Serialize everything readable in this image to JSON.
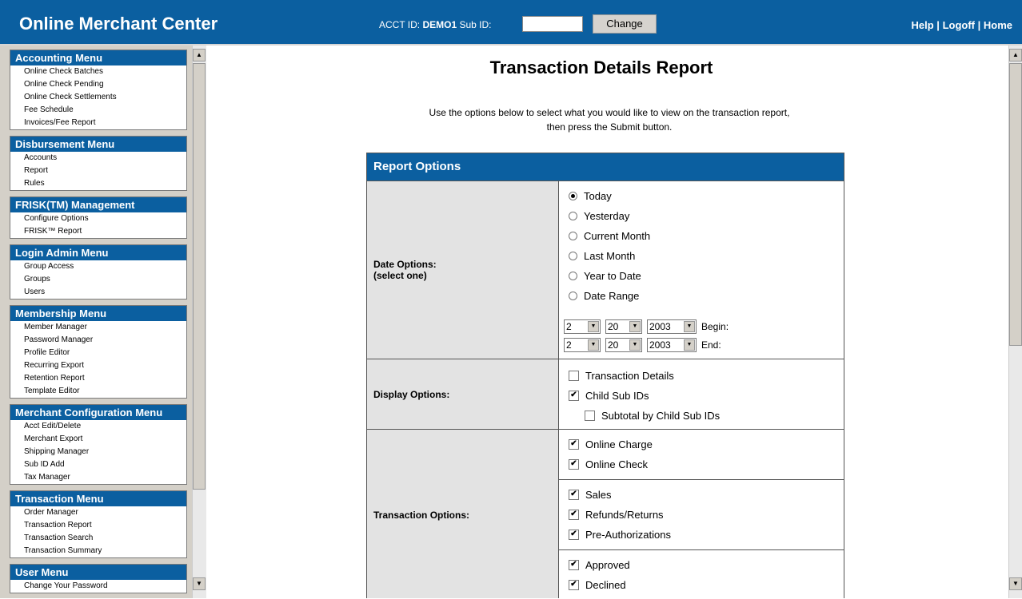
{
  "header": {
    "app_title": "Online Merchant Center",
    "acct_label": "ACCT ID:",
    "acct_value": "DEMO1",
    "subid_label": "Sub ID:",
    "subid_value": "",
    "change_label": "Change",
    "links": {
      "help": "Help",
      "logoff": "Logoff",
      "home": "Home",
      "sep": "|"
    }
  },
  "sidebar": {
    "menus": [
      {
        "title": "Accounting Menu",
        "items": [
          "Online Check Batches",
          "Online Check Pending",
          "Online Check Settlements",
          "Fee Schedule",
          "Invoices/Fee Report"
        ]
      },
      {
        "title": "Disbursement Menu",
        "items": [
          "Accounts",
          "Report",
          "Rules"
        ]
      },
      {
        "title": "FRISK(TM) Management",
        "items": [
          "Configure Options",
          "FRISK™ Report"
        ]
      },
      {
        "title": "Login Admin Menu",
        "items": [
          "Group Access",
          "Groups",
          "Users"
        ]
      },
      {
        "title": "Membership Menu",
        "items": [
          "Member Manager",
          "Password Manager",
          "Profile Editor",
          "Recurring Export",
          "Retention Report",
          "Template Editor"
        ]
      },
      {
        "title": "Merchant Configuration Menu",
        "items": [
          "Acct Edit/Delete",
          "Merchant Export",
          "Shipping Manager",
          "Sub ID Add",
          "Tax Manager"
        ]
      },
      {
        "title": "Transaction Menu",
        "items": [
          "Order Manager",
          "Transaction Report",
          "Transaction Search",
          "Transaction Summary"
        ]
      },
      {
        "title": "User Menu",
        "items": [
          "Change Your Password"
        ]
      }
    ]
  },
  "main": {
    "title": "Transaction Details Report",
    "intro_line1": "Use the options below to select what you would like to view on the transaction report,",
    "intro_line2": "then press the Submit button.",
    "report": {
      "heading": "Report Options",
      "date": {
        "label_line1": "Date Options:",
        "label_line2": "(select one)",
        "options": [
          {
            "label": "Today",
            "checked": true
          },
          {
            "label": "Yesterday",
            "checked": false
          },
          {
            "label": "Current Month",
            "checked": false
          },
          {
            "label": "Last Month",
            "checked": false
          },
          {
            "label": "Year to Date",
            "checked": false
          },
          {
            "label": "Date Range",
            "checked": false
          }
        ],
        "begin": {
          "month": "2",
          "day": "20",
          "year": "2003",
          "label": "Begin:"
        },
        "end": {
          "month": "2",
          "day": "20",
          "year": "2003",
          "label": "End:"
        }
      },
      "display": {
        "label": "Display Options:",
        "options": [
          {
            "label": "Transaction Details",
            "checked": false
          },
          {
            "label": "Child Sub IDs",
            "checked": true
          },
          {
            "label": "Subtotal by Child Sub IDs",
            "checked": false
          }
        ]
      },
      "transaction": {
        "label": "Transaction Options:",
        "group1": [
          {
            "label": "Online Charge",
            "checked": true
          },
          {
            "label": "Online Check",
            "checked": true
          }
        ],
        "group2": [
          {
            "label": "Sales",
            "checked": true
          },
          {
            "label": "Refunds/Returns",
            "checked": true
          },
          {
            "label": "Pre-Authorizations",
            "checked": true
          }
        ],
        "group3": [
          {
            "label": "Approved",
            "checked": true
          },
          {
            "label": "Declined",
            "checked": true
          }
        ]
      }
    }
  }
}
